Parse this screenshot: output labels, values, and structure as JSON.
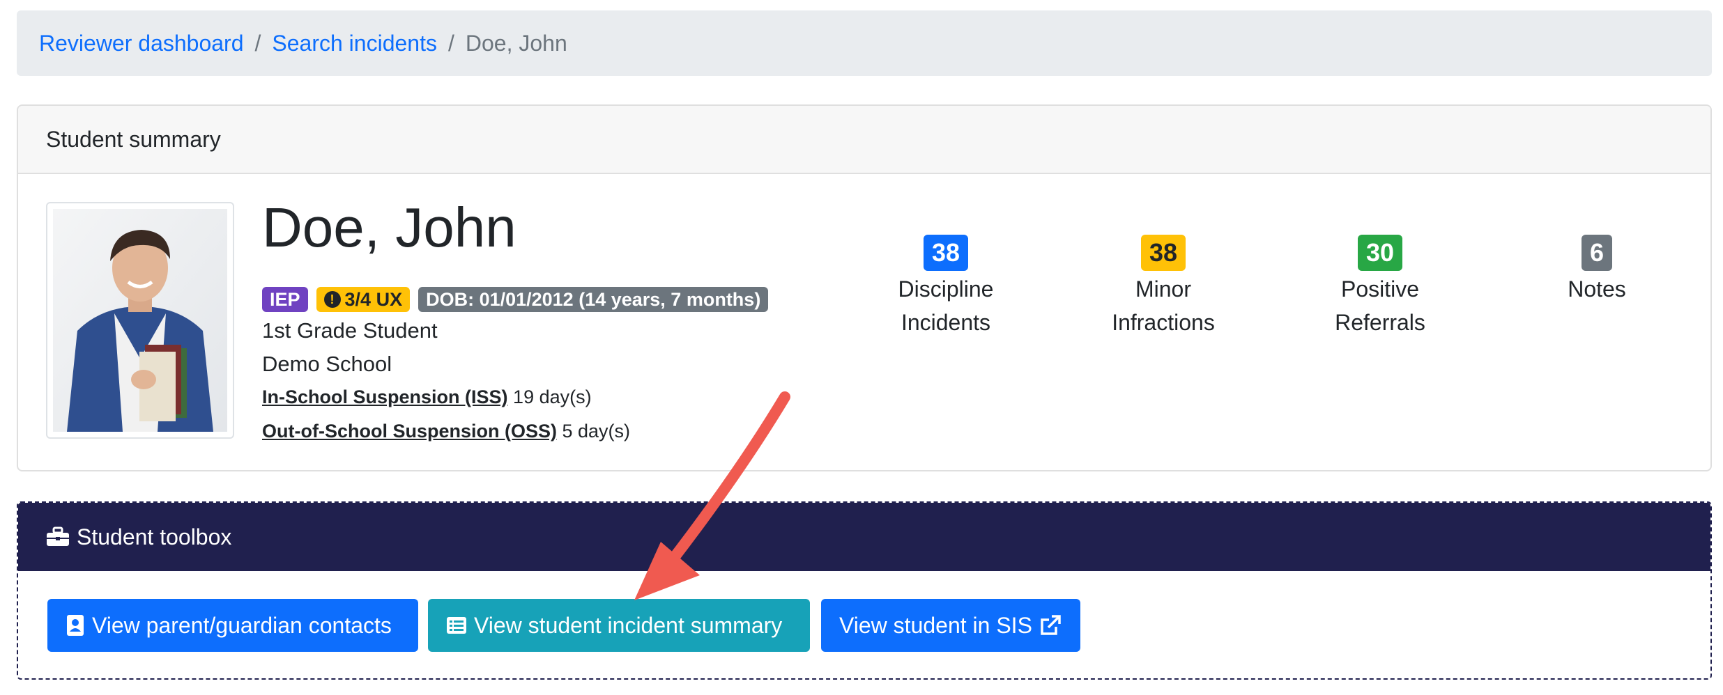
{
  "breadcrumb": {
    "items": [
      {
        "label": "Reviewer dashboard"
      },
      {
        "label": "Search incidents"
      }
    ],
    "separator": "/",
    "current": "Doe, John"
  },
  "summary": {
    "header": "Student summary",
    "name": "Doe, John",
    "badges": {
      "iep": "IEP",
      "ux": "3/4 UX",
      "dob": "DOB: 01/01/2012 (14 years, 7 months)"
    },
    "grade": "1st Grade Student",
    "school": "Demo School",
    "iss": {
      "label": "In-School Suspension (ISS)",
      "value": "19 day(s)"
    },
    "oss": {
      "label": "Out-of-School Suspension (OSS)",
      "value": "5 day(s)"
    },
    "stats": [
      {
        "count": "38",
        "line1": "Discipline",
        "line2": "Incidents",
        "color": "#0d6efd",
        "text_color": "#ffffff"
      },
      {
        "count": "38",
        "line1": "Minor",
        "line2": "Infractions",
        "color": "#ffc107",
        "text_color": "#212529"
      },
      {
        "count": "30",
        "line1": "Positive",
        "line2": "Referrals",
        "color": "#28a745",
        "text_color": "#ffffff"
      },
      {
        "count": "6",
        "line1": "Notes",
        "line2": "",
        "color": "#6c757d",
        "text_color": "#ffffff"
      }
    ]
  },
  "toolbox": {
    "header": "Student toolbox",
    "icon": "toolbox-icon",
    "buttons": [
      {
        "label": "View parent/guardian contacts",
        "icon": "contact-card-icon"
      },
      {
        "label": "View student incident summary",
        "icon": "list-icon"
      },
      {
        "label": "View student in SIS",
        "icon": "external-link-icon"
      }
    ]
  },
  "colors": {
    "primary": "#0d6efd",
    "info": "#17a2b8",
    "toolbox_header": "#20204e",
    "annotation_arrow": "#f05a50"
  }
}
